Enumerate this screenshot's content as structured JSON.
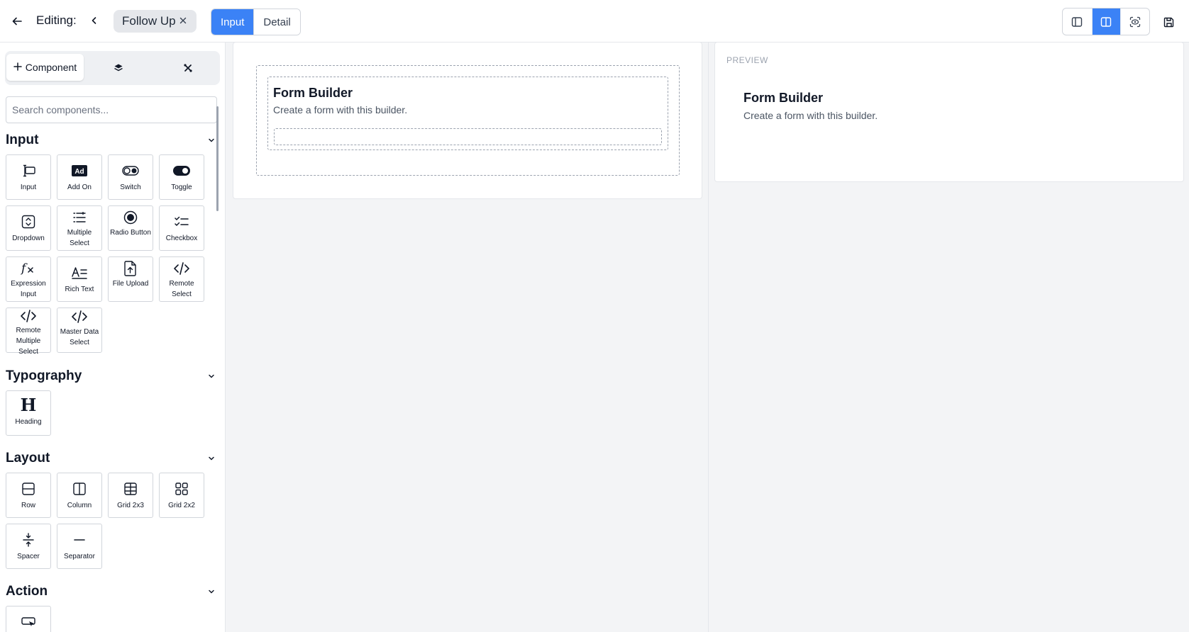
{
  "header": {
    "editing_label": "Editing:",
    "form_tab": "Follow Up",
    "mode_tabs": [
      {
        "label": "Input",
        "active": true
      },
      {
        "label": "Detail",
        "active": false
      }
    ],
    "view_buttons": [
      "panel-left-icon",
      "panel-split-icon",
      "scan-eye-icon"
    ],
    "save_icon": "save-icon",
    "accent_color": "#3b82f6"
  },
  "sidebar": {
    "tabs": {
      "component_label": "Component"
    },
    "search": {
      "placeholder": "Search components...",
      "value": ""
    },
    "sections": [
      {
        "title": "Input",
        "items": [
          "Input",
          "Add On",
          "Switch",
          "Toggle",
          "Dropdown",
          "Multiple Select",
          "Radio Button",
          "Checkbox",
          "Expression Input",
          "Rich Text",
          "File Upload",
          "Remote Select",
          "Remote Multiple Select",
          "Master Data Select"
        ]
      },
      {
        "title": "Typography",
        "items": [
          "Heading"
        ]
      },
      {
        "title": "Layout",
        "items": [
          "Row",
          "Column",
          "Grid 2x3",
          "Grid 2x2",
          "Spacer",
          "Separator"
        ]
      },
      {
        "title": "Action",
        "items": []
      }
    ]
  },
  "canvas": {
    "title": "Form Builder",
    "subtitle": "Create a form with this builder."
  },
  "preview": {
    "label": "PREVIEW",
    "title": "Form Builder",
    "subtitle": "Create a form with this builder."
  }
}
